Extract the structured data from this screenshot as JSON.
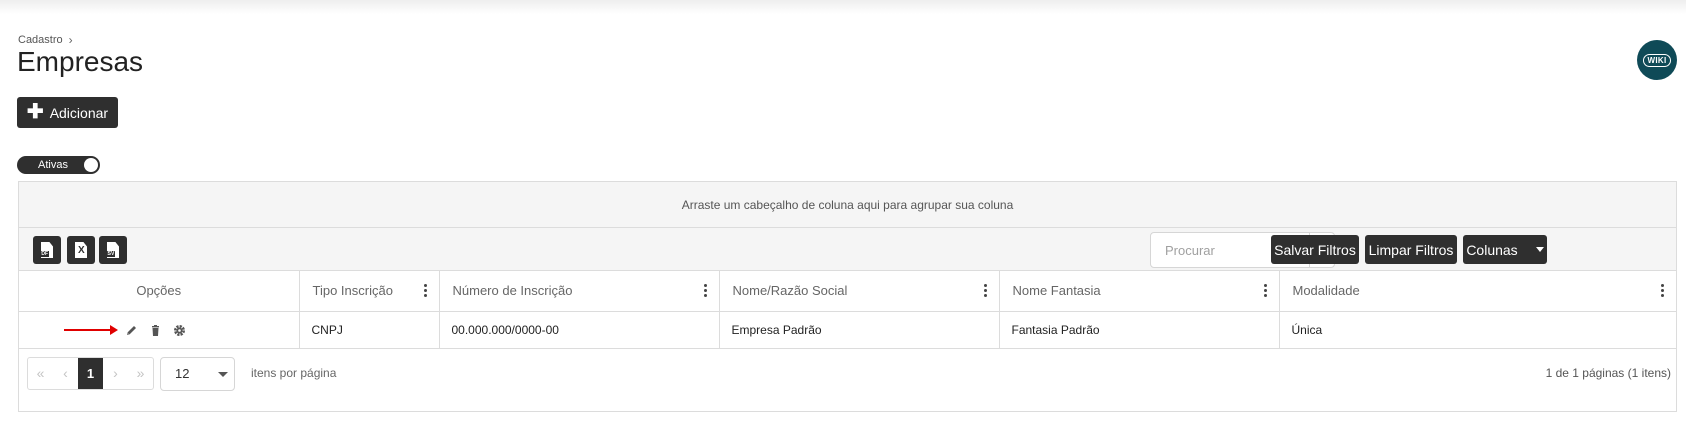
{
  "breadcrumb": {
    "parent": "Cadastro"
  },
  "page": {
    "title": "Empresas"
  },
  "wiki": {
    "label": "WIKI"
  },
  "actions": {
    "add_label": "Adicionar"
  },
  "filter_toggle": {
    "label": "Ativas",
    "state": "on"
  },
  "grid": {
    "group_panel_text": "Arraste um cabeçalho de coluna aqui para agrupar sua coluna",
    "export_buttons": [
      {
        "format": "PDF",
        "icon": "pdf-file-icon"
      },
      {
        "format": "X",
        "icon": "excel-file-icon"
      },
      {
        "format": "CSV",
        "icon": "csv-file-icon"
      }
    ],
    "search_placeholder": "Procurar",
    "save_filters_label": "Salvar Filtros",
    "clear_filters_label": "Limpar Filtros",
    "columns_label": "Colunas",
    "headers": {
      "options": "Opções",
      "tipo_inscricao": "Tipo Inscrição",
      "numero_inscricao": "Número de Inscrição",
      "nome_razao_social": "Nome/Razão Social",
      "nome_fantasia": "Nome Fantasia",
      "modalidade": "Modalidade"
    },
    "rows": [
      {
        "tipo_inscricao": "CNPJ",
        "numero_inscricao": "00.000.000/0000-00",
        "nome_razao_social": "Empresa Padrão",
        "nome_fantasia": "Fantasia Padrão",
        "modalidade": "Única",
        "option_icons": [
          "pencil-icon",
          "trash-icon",
          "gear-icon"
        ]
      }
    ],
    "annotation": {
      "arrow_color": "#e00000",
      "points_to": "pencil-icon"
    }
  },
  "pagination": {
    "first": "«",
    "prev": "‹",
    "current_page": "1",
    "next": "›",
    "last": "»",
    "page_size": "12",
    "per_page_label": "itens por página",
    "info": "1 de 1 páginas (1 itens)"
  },
  "colors": {
    "primary_dark": "#2f2f2f",
    "wiki_badge": "#0f4a57",
    "panel_bg": "#f5f5f5",
    "border": "#dcdcdc"
  }
}
